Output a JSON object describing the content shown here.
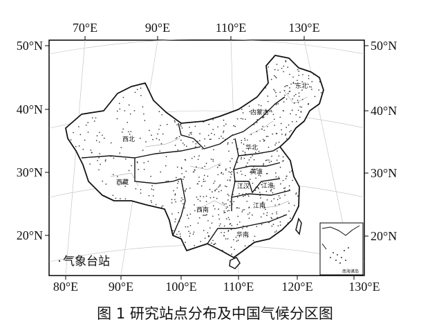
{
  "top_lon_labels": [
    "70°E",
    "90°E",
    "110°E",
    "130°E"
  ],
  "bottom_lon_labels": [
    "80°E",
    "90°E",
    "100°E",
    "110°E",
    "120°E",
    "130°E"
  ],
  "left_lat_labels": [
    "50°N",
    "40°N",
    "30°N",
    "20°N"
  ],
  "right_lat_labels": [
    "50°N",
    "40°N",
    "30°N",
    "20°N"
  ],
  "regions": [
    "东北",
    "内蒙古",
    "西北",
    "华北",
    "黄淮",
    "江汉",
    "江淮",
    "西藏",
    "西南",
    "江南",
    "华南"
  ],
  "legend_label": "气象台站",
  "inset_label": "南海诸岛",
  "caption": "图 1  研究站点分布及中国气候分区图",
  "colors": {
    "border": "#111111",
    "graticule": "#bdbdbd",
    "station": "#333333",
    "frame": "#000000"
  }
}
